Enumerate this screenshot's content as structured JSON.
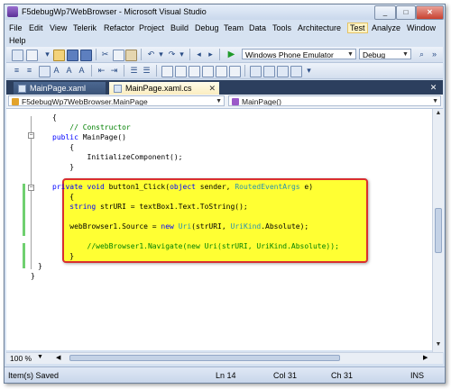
{
  "window": {
    "title": "F5debugWp7WebBrowser - Microsoft Visual Studio"
  },
  "window_controls": {
    "minimize": "_",
    "maximize": "□",
    "close": "✕"
  },
  "menu": [
    "File",
    "Edit",
    "View",
    "Telerik",
    "Refactor",
    "Project",
    "Build",
    "Debug",
    "Team",
    "Data",
    "Tools",
    "Architecture",
    "Test",
    "Analyze",
    "Window",
    "Help"
  ],
  "active_menu": "Test",
  "toolbar": {
    "target": "Windows Phone Emulator",
    "configuration": "Debug"
  },
  "tabs": [
    {
      "label": "MainPage.xaml",
      "active": false
    },
    {
      "label": "MainPage.xaml.cs",
      "active": true
    }
  ],
  "navbar": {
    "type": "F5debugWp7WebBrowser.MainPage",
    "member": "MainPage()"
  },
  "code": {
    "lines": [
      "{",
      "    // Constructor",
      "    public MainPage()",
      "    {",
      "        InitializeComponent();",
      "    }",
      "",
      "    private void button1_Click(object sender, RoutedEventArgs e)",
      "    {",
      "        string strURI = textBox1.Text.ToString();",
      "",
      "        webBrowser1.Source = new Uri(strURI, UriKind.Absolute);",
      "",
      "        //webBrowser1.Navigate(new Uri(strURI, UriKind.Absolute));",
      "    }",
      "}",
      "}"
    ]
  },
  "zoom": "100 %",
  "status": {
    "message": "Item(s) Saved",
    "line": "Ln 14",
    "col": "Col 31",
    "ch": "Ch 31",
    "mode": "INS"
  }
}
